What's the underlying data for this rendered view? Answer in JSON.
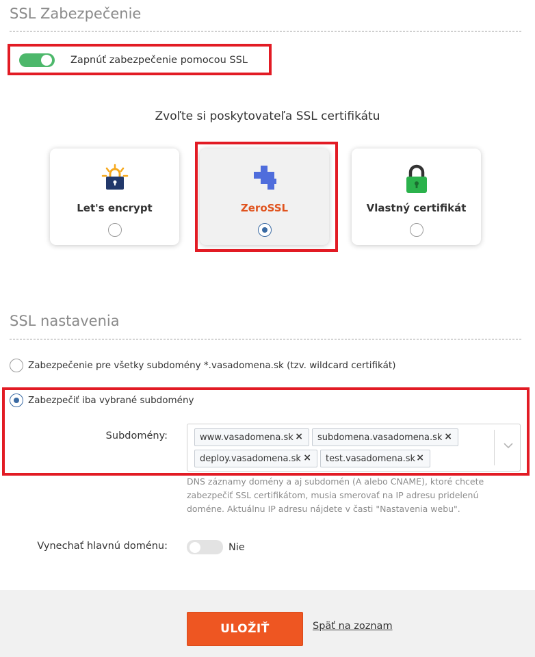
{
  "ssl_security": {
    "title": "SSL Zabezpečenie",
    "toggle_label": "Zapnúť zabezpečenie pomocou SSL",
    "toggle_on": true
  },
  "provider": {
    "heading": "Zvoľte si poskytovateľa SSL certifikátu",
    "cards": [
      {
        "label": "Let's encrypt",
        "icon": "sun-lock-icon",
        "selected": false
      },
      {
        "label": "ZeroSSL",
        "icon": "puzzle-icon",
        "selected": true
      },
      {
        "label": "Vlastný certifikát",
        "icon": "green-lock-icon",
        "selected": false
      }
    ]
  },
  "settings": {
    "title": "SSL nastavenia",
    "option_wildcard": "Zabezpečenie pre všetky subdomény *.vasadomena.sk (tzv. wildcard certifikát)",
    "option_selected": "Zabezpečiť iba vybrané subdomény",
    "subdomains_label": "Subdomény:",
    "subdomains": [
      "www.vasadomena.sk",
      "subdomena.vasadomena.sk",
      "deploy.vasadomena.sk",
      "test.vasadomena.sk"
    ],
    "remove_symbol": "×",
    "help_text": "DNS záznamy domény a aj subdomén (A alebo CNAME), ktoré chcete zabezpečiť SSL certifikátom, musia smerovať na IP adresu pridelenú doméne. Aktuálnu IP adresu nájdete v časti \"Nastavenia webu\".",
    "skip_main_label": "Vynechať hlavnú doménu:",
    "skip_main_value": "Nie",
    "skip_main_on": false
  },
  "footer": {
    "save_label": "ULOŽIŤ",
    "back_label": "Späť na zoznam"
  },
  "colors": {
    "accent": "#ee5622",
    "toggle_on": "#4db86b",
    "radio": "#3a6aa3",
    "highlight": "#e21b24"
  }
}
